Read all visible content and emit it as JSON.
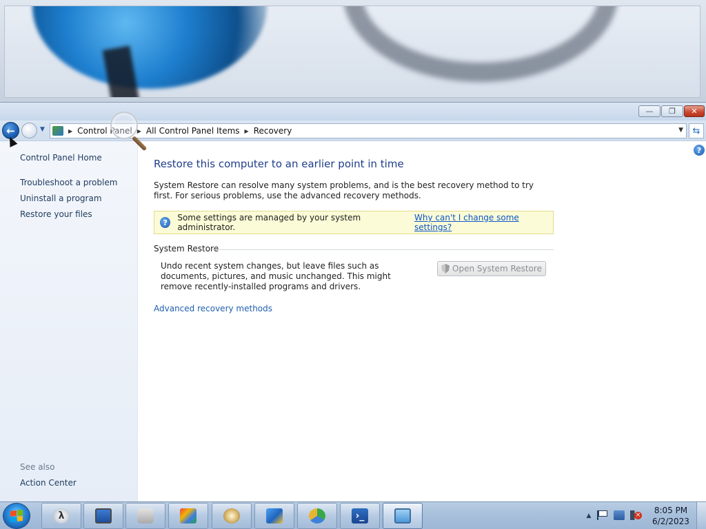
{
  "window": {
    "controls": {
      "minimize_icon": "—",
      "restore_icon": "❐",
      "close_icon": "✕"
    }
  },
  "address_bar": {
    "breadcrumbs": [
      "Control Panel",
      "All Control Panel Items",
      "Recovery"
    ]
  },
  "left_pane": {
    "home": "Control Panel Home",
    "links": [
      "Troubleshoot a problem",
      "Uninstall a program",
      "Restore your files"
    ],
    "see_also_label": "See also",
    "see_also_links": [
      "Action Center"
    ]
  },
  "main": {
    "title": "Restore this computer to an earlier point in time",
    "description": "System Restore can resolve many system problems, and is the best recovery method to try first. For serious problems, use the advanced recovery methods.",
    "info_bar": {
      "text": "Some settings are managed by your system administrator.",
      "link": "Why can't I change some settings?"
    },
    "system_restore": {
      "title": "System Restore",
      "description": "Undo recent system changes, but leave files such as documents, pictures, and music unchanged. This might remove recently-installed programs and drivers.",
      "button": "Open System Restore",
      "button_enabled": false
    },
    "advanced_link": "Advanced recovery methods"
  },
  "taskbar": {
    "clock_time": "8:05 PM",
    "clock_date": "6/2/2023",
    "pinned": [
      {
        "icon": "lambda-icon"
      },
      {
        "icon": "monitor-icon"
      },
      {
        "icon": "drive-icon"
      },
      {
        "icon": "control-panel-items-icon"
      },
      {
        "icon": "gauge-icon"
      },
      {
        "icon": "network-users-icon"
      },
      {
        "icon": "sync-icon"
      },
      {
        "icon": "powershell-icon"
      },
      {
        "icon": "control-panel-icon",
        "active": true
      }
    ]
  }
}
